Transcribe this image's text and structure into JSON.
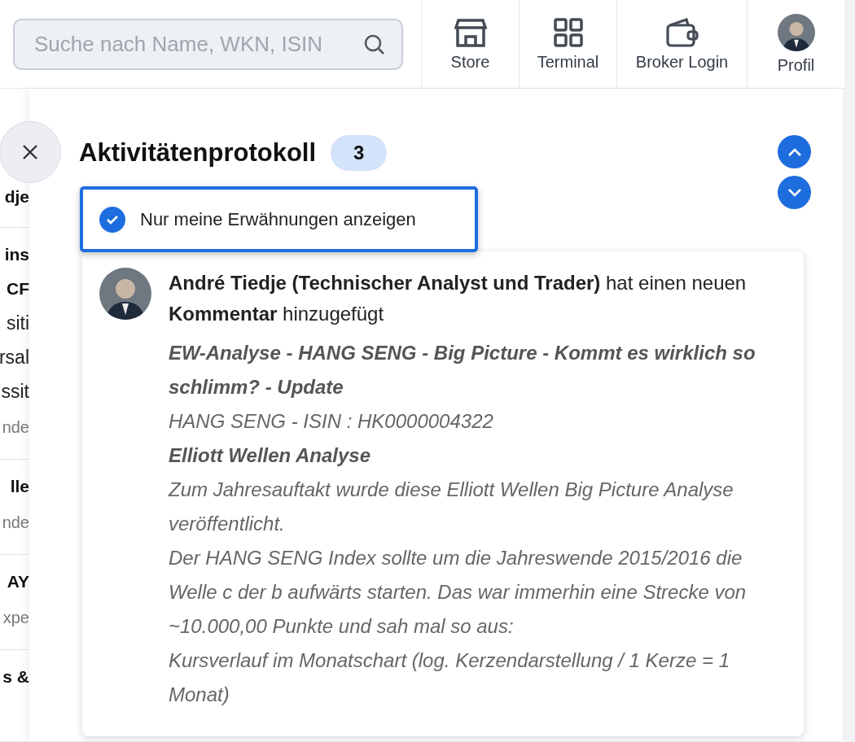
{
  "search": {
    "placeholder": "Suche nach Name, WKN, ISIN"
  },
  "nav": [
    {
      "label": "Store",
      "kind": "store"
    },
    {
      "label": "Terminal",
      "kind": "grid"
    },
    {
      "label": "Broker Login",
      "kind": "wallet"
    },
    {
      "label": "Profil",
      "kind": "avatar"
    }
  ],
  "sidebar_groups": [
    [
      {
        "text": "dje",
        "kind": "title"
      }
    ],
    [
      {
        "text": "ins",
        "kind": "title"
      },
      {
        "text": "CF",
        "kind": "title"
      },
      {
        "text": "siti",
        "kind": "text"
      },
      {
        "text": "rsal",
        "kind": "text"
      },
      {
        "text": "ssit",
        "kind": "text"
      },
      {
        "text": "nde",
        "kind": "meta"
      }
    ],
    [
      {
        "text": "lle",
        "kind": "title"
      },
      {
        "text": "nde",
        "kind": "meta"
      }
    ],
    [
      {
        "text": "AY",
        "kind": "title"
      },
      {
        "text": "xpe",
        "kind": "meta"
      }
    ],
    [
      {
        "text": "s &",
        "kind": "title"
      }
    ]
  ],
  "panel": {
    "title": "Aktivitätenprotokoll",
    "count": "3",
    "filter": {
      "label": "Nur meine Erwähnungen anzeigen",
      "checked": true
    },
    "entries": [
      {
        "headline": "**André Tiedje (Technischer Analyst und Trader)** hat einen neuen **Kommentar** hinzugefügt",
        "body": [
          {
            "kind": "heading",
            "text": "EW-Analyse - HANG SENG - Big Picture - Kommt es wirklich so schlimm? - Update"
          },
          {
            "kind": "text",
            "text": "HANG SENG - ISIN : HK0000004322"
          },
          {
            "kind": "heading",
            "text": "Elliott Wellen Analyse"
          },
          {
            "kind": "text",
            "text": "Zum Jahresauftakt wurde diese Elliott Wellen Big Picture Analyse veröffentlicht."
          },
          {
            "kind": "text",
            "text": "Der HANG SENG Index sollte um die Jahreswende 2015/2016 die Welle c der b aufwärts starten. Das war immerhin eine Strecke von ~10.000,00 Punkte und sah mal so aus:"
          },
          {
            "kind": "text",
            "text": "Kursverlauf im Monatschart (log. Kerzendarstellung / 1 Kerze = 1 Monat)"
          }
        ]
      }
    ]
  }
}
